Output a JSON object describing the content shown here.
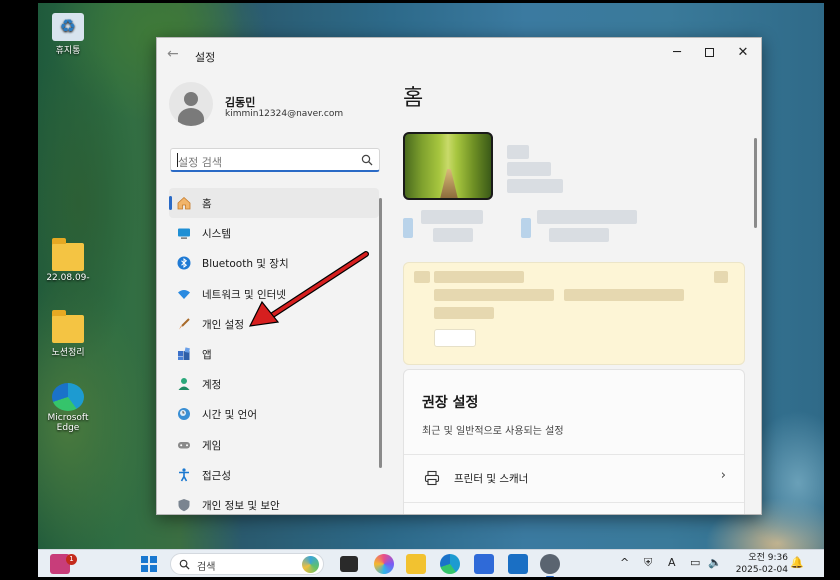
{
  "desktop": {
    "icons": [
      {
        "label": "휴지통"
      },
      {
        "label": "22.08.09-"
      },
      {
        "label": "노션정리"
      },
      {
        "label": "Microsoft Edge"
      }
    ]
  },
  "window": {
    "title": "설정",
    "controls": {
      "minimize": "─",
      "maximize": "",
      "close": "✕"
    }
  },
  "profile": {
    "name": "김동민",
    "email": "kimmin12324@naver.com"
  },
  "search": {
    "placeholder": "설정 검색"
  },
  "nav": {
    "items": [
      {
        "label": "홈",
        "icon": "home-icon"
      },
      {
        "label": "시스템",
        "icon": "system-icon"
      },
      {
        "label": "Bluetooth 및 장치",
        "icon": "bluetooth-icon"
      },
      {
        "label": "네트워크 및 인터넷",
        "icon": "wifi-icon"
      },
      {
        "label": "개인 설정",
        "icon": "brush-icon"
      },
      {
        "label": "앱",
        "icon": "apps-icon"
      },
      {
        "label": "계정",
        "icon": "account-icon"
      },
      {
        "label": "시간 및 언어",
        "icon": "globe-icon"
      },
      {
        "label": "게임",
        "icon": "gamepad-icon"
      },
      {
        "label": "접근성",
        "icon": "accessibility-icon"
      },
      {
        "label": "개인 정보 및 보안",
        "icon": "shield-icon"
      }
    ]
  },
  "main": {
    "title": "홈",
    "recommended": {
      "title": "권장 설정",
      "subtitle": "최근 및 일반적으로 사용되는 설정",
      "items": [
        {
          "label": "프린터 및 스캐너",
          "chevron": "›"
        }
      ]
    }
  },
  "taskbar": {
    "search_label": "검색",
    "notification_badge": "1",
    "clock_time": "오전 9:36",
    "clock_date": "2025-02-04",
    "tray_chevron": "^",
    "tray_lang": "A"
  },
  "colors": {
    "accent": "#2a6ac6",
    "annotation_arrow": "#d61f1f"
  }
}
